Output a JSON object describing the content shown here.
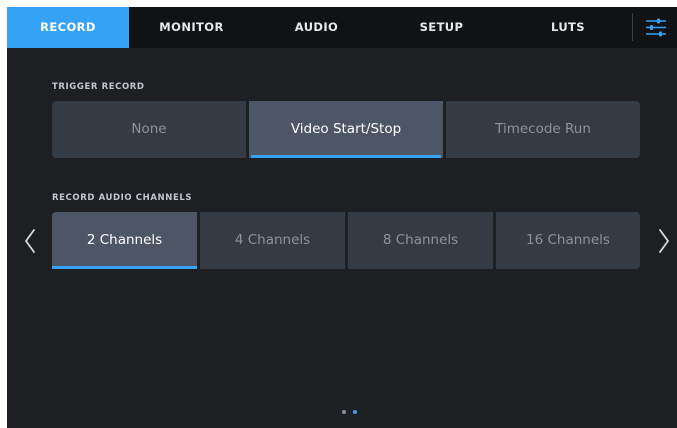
{
  "tabs": [
    {
      "label": "RECORD",
      "active": true
    },
    {
      "label": "MONITOR",
      "active": false
    },
    {
      "label": "AUDIO",
      "active": false
    },
    {
      "label": "SETUP",
      "active": false
    },
    {
      "label": "LUTS",
      "active": false
    }
  ],
  "settings_icon": "sliders-icon",
  "trigger_record": {
    "label": "TRIGGER RECORD",
    "options": [
      "None",
      "Video Start/Stop",
      "Timecode Run"
    ],
    "selected": "Video Start/Stop"
  },
  "record_audio_channels": {
    "label": "RECORD AUDIO CHANNELS",
    "options": [
      "2 Channels",
      "4 Channels",
      "8 Channels",
      "16 Channels"
    ],
    "selected": "2 Channels"
  },
  "pagination": {
    "total_pages": 2,
    "current_page": 2
  },
  "icons": {
    "prev": "chevron-left-icon",
    "next": "chevron-right-icon"
  },
  "colors": {
    "accent": "#35a2f5",
    "background": "#1d1f23",
    "tabbar": "#111214",
    "button": "#353b45",
    "button_selected": "#4c5666",
    "dot_inactive": "#8a8f97"
  }
}
